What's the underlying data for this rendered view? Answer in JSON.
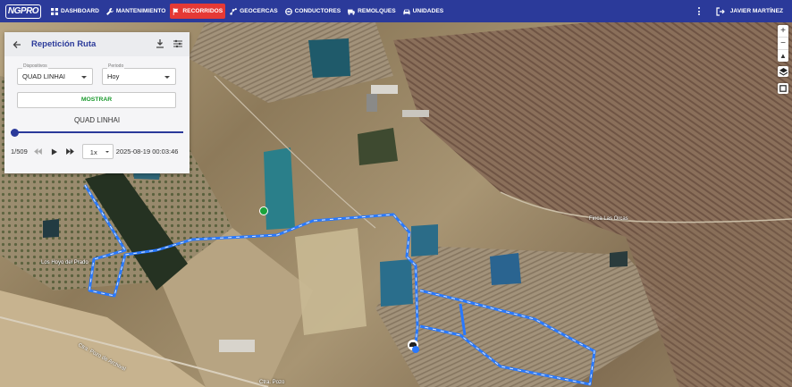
{
  "app": {
    "logo": "NGPRO"
  },
  "nav": {
    "items": [
      {
        "label": "DASHBOARD",
        "icon": "dashboard-icon"
      },
      {
        "label": "MANTENIMIENTO",
        "icon": "wrench-icon"
      },
      {
        "label": "RECORRIDOS",
        "icon": "flag-icon",
        "active": true
      },
      {
        "label": "GEOCERCAS",
        "icon": "geofence-icon"
      },
      {
        "label": "CONDUCTORES",
        "icon": "steering-wheel-icon"
      },
      {
        "label": "REMOLQUES",
        "icon": "trailer-icon"
      },
      {
        "label": "UNIDADES",
        "icon": "car-icon"
      }
    ],
    "user": "JAVIER MARTÍNEZ"
  },
  "panel": {
    "title": "Repetición Ruta",
    "device_label": "Dispositivos",
    "device_value": "QUAD LINHAI",
    "period_label": "Periodo",
    "period_value": "Hoy",
    "show_button": "MOSTRAR",
    "device_name": "QUAD LINHAI",
    "progress": {
      "current": 1,
      "total": 509,
      "text": "1/509"
    },
    "speed": "1x",
    "timestamp": "2025-08-19 00:03:46"
  },
  "map": {
    "labels": {
      "finca": "Finca Las Orcas",
      "hoya": "Los Hoyo del Prado",
      "road": "Ctra. Pozo de Archival",
      "road2": "Ctra. Pozo"
    },
    "route_color": "#2979ff"
  }
}
